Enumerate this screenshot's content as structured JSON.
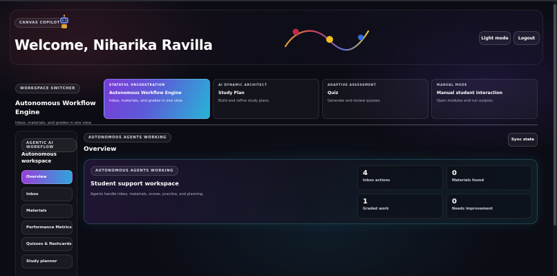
{
  "header": {
    "brand": "CANVAS COPILOT",
    "welcome": "Welcome, Niharika Ravilla",
    "light_mode": "Light mode",
    "logout": "Logout"
  },
  "workspace": {
    "switcher_label": "WORKSPACE SWITCHER",
    "title": "Autonomous Workflow Engine",
    "subtitle": "Inbox, materials, and grades in one view.",
    "cards": [
      {
        "kicker": "STATEFUL ORCHESTRATION",
        "title": "Autonomous Workflow Engine",
        "desc": "Inbox, materials, and grades in one view."
      },
      {
        "kicker": "AI DYNAMIC ARCHITECT",
        "title": "Study Plan",
        "desc": "Build and refine study plans."
      },
      {
        "kicker": "ADAPTIVE ASSESSMENT",
        "title": "Quiz",
        "desc": "Generate and review quizzes."
      },
      {
        "kicker": "MANUAL MODE",
        "title": "Manual student interaction",
        "desc": "Open modules and run outputs."
      }
    ]
  },
  "sidebar": {
    "label": "AGENTIC AI WORKFLOW",
    "title": "Autonomous workspace",
    "items": [
      {
        "label": "Overview"
      },
      {
        "label": "Inbox"
      },
      {
        "label": "Materials"
      },
      {
        "label": "Performance Metrics"
      },
      {
        "label": "Quizzes & flashcards"
      },
      {
        "label": "Study planner"
      }
    ]
  },
  "main": {
    "status_label": "AUTONOMOUS AGENTS WORKING",
    "title": "Overview",
    "sync": "Sync state",
    "panel": {
      "label": "AUTONOMOUS AGENTS WORKING",
      "title": "Student support workspace",
      "desc": "Agents handle inbox, materials, scores, practice, and planning.",
      "stats": [
        {
          "value": "4",
          "label": "Inbox actions"
        },
        {
          "value": "0",
          "label": "Materials found"
        },
        {
          "value": "1",
          "label": "Graded work"
        },
        {
          "value": "0",
          "label": "Needs improvement"
        }
      ]
    }
  },
  "colors": {
    "accent_purple": "#9640d8",
    "accent_cyan": "#27b5d6",
    "background": "#0c0c14"
  }
}
